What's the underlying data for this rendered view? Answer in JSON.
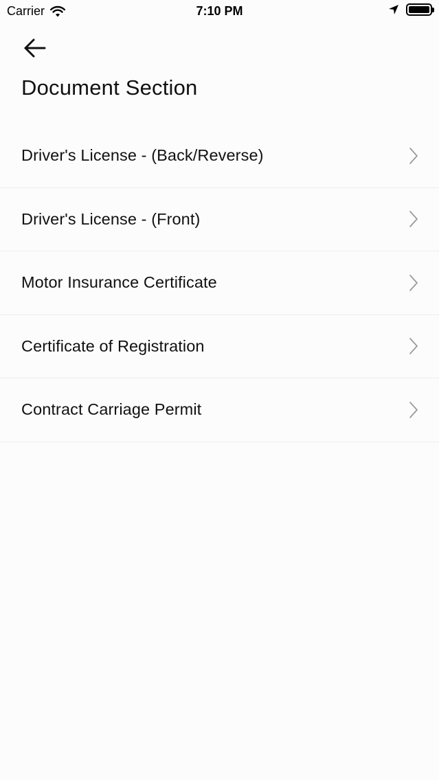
{
  "status_bar": {
    "carrier": "Carrier",
    "time": "7:10 PM",
    "icons": [
      "wifi-icon",
      "location-arrow-icon",
      "battery-icon"
    ]
  },
  "header": {
    "back_icon": "arrow-left-icon",
    "title": "Document Section"
  },
  "documents": [
    {
      "label": "Driver's License - (Back/Reverse)",
      "icon": "chevron-right-icon"
    },
    {
      "label": "Driver's License - (Front)",
      "icon": "chevron-right-icon"
    },
    {
      "label": "Motor Insurance Certificate",
      "icon": "chevron-right-icon"
    },
    {
      "label": "Certificate of Registration",
      "icon": "chevron-right-icon"
    },
    {
      "label": "Contract Carriage Permit",
      "icon": "chevron-right-icon"
    }
  ],
  "colors": {
    "background": "#fdfcfd",
    "text": "#111111",
    "divider": "#ececee",
    "chevron": "#9a9a9e"
  }
}
